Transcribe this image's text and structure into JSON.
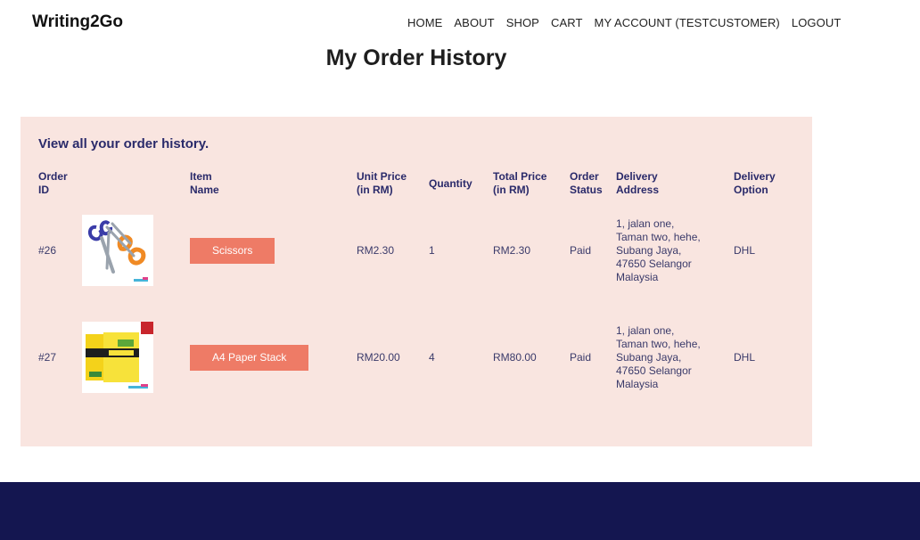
{
  "brand": "Writing2Go",
  "nav": [
    "HOME",
    "ABOUT",
    "SHOP",
    "CART",
    "MY ACCOUNT (TESTCUSTOMER)",
    "LOGOUT"
  ],
  "page_title": "My Order History",
  "panel": {
    "subtitle": "View all your order history.",
    "headers": {
      "order_id": "Order\nID",
      "item_name": "Item\nName",
      "unit_price": "Unit Price\n(in RM)",
      "quantity": "Quantity",
      "total_price": "Total Price\n(in RM)",
      "order_status": "Order\nStatus",
      "delivery_address": "Delivery\nAddress",
      "delivery_option": "Delivery\nOption"
    },
    "orders": [
      {
        "id": "#26",
        "image": "scissors-product-image",
        "item": "Scissors",
        "unit_price": "RM2.30",
        "quantity": "1",
        "total_price": "RM2.30",
        "status": "Paid",
        "address": "1, jalan one,\nTaman two, hehe,\nSubang Jaya,\n47650 Selangor\nMalaysia",
        "delivery": "DHL"
      },
      {
        "id": "#27",
        "image": "a4-paper-product-image",
        "item": "A4 Paper Stack",
        "unit_price": "RM20.00",
        "quantity": "4",
        "total_price": "RM80.00",
        "status": "Paid",
        "address": "1, jalan one,\nTaman two, hehe,\nSubang Jaya,\n47650 Selangor\nMalaysia",
        "delivery": "DHL"
      }
    ]
  },
  "colors": {
    "panel_bg": "#f9e5e0",
    "accent_button": "#ee7b66",
    "heading_text": "#2a2a6a",
    "footer_bg": "#141650"
  }
}
